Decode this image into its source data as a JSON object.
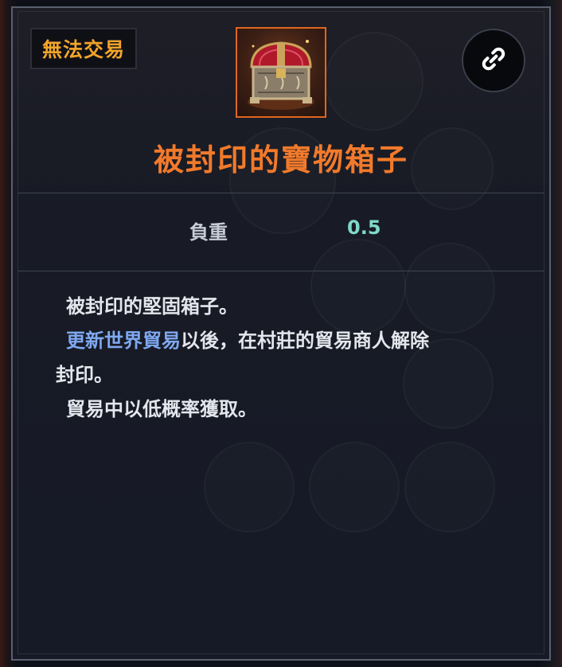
{
  "badge": {
    "text": "無法交易"
  },
  "item": {
    "icon": "treasure-chest-icon",
    "name": "被封印的寶物箱子"
  },
  "link_button": {
    "icon": "link-icon"
  },
  "stats": [
    {
      "label": "負重",
      "value": "0.5"
    }
  ],
  "description": {
    "line1": "被封印的堅固箱子。",
    "line2_highlight": "更新世界貿易",
    "line2_rest": "以後，在村莊的貿易商人解除",
    "line3": "封印。",
    "line4": "貿易中以低概率獲取。"
  },
  "colors": {
    "title": "#f27a2b",
    "badge_text": "#f2a42a",
    "stat_value": "#7fd8c8",
    "highlight": "#7fa8f0",
    "icon_border": "#e0671f"
  }
}
